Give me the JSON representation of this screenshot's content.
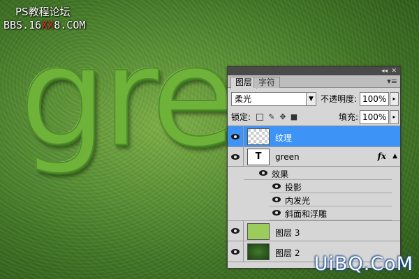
{
  "watermark": {
    "line1": "PS教程论坛",
    "line2_prefix": "BBS.16",
    "line2_red": "XX",
    "line2_suffix": "8.COM"
  },
  "canvas_text": "green",
  "panel": {
    "tabs": [
      "图层",
      "字符"
    ],
    "blend_mode": "柔光",
    "opacity_label": "不透明度:",
    "opacity_value": "100%",
    "lock_label": "锁定:",
    "fill_label": "填充:",
    "fill_value": "100%",
    "layers": [
      {
        "name": "纹理",
        "selected": true
      },
      {
        "name": "green",
        "type_glyph": "T",
        "fx": "fx"
      },
      {
        "name": "图层 3"
      },
      {
        "name": "图层 2"
      }
    ],
    "effects": {
      "header": "效果",
      "items": [
        "投影",
        "内发光",
        "斜面和浮雕"
      ]
    }
  },
  "logo": "UiBQ.CoM",
  "colors": {
    "selected_row": "#3d94f6",
    "watermark_red": "#e0322a"
  }
}
